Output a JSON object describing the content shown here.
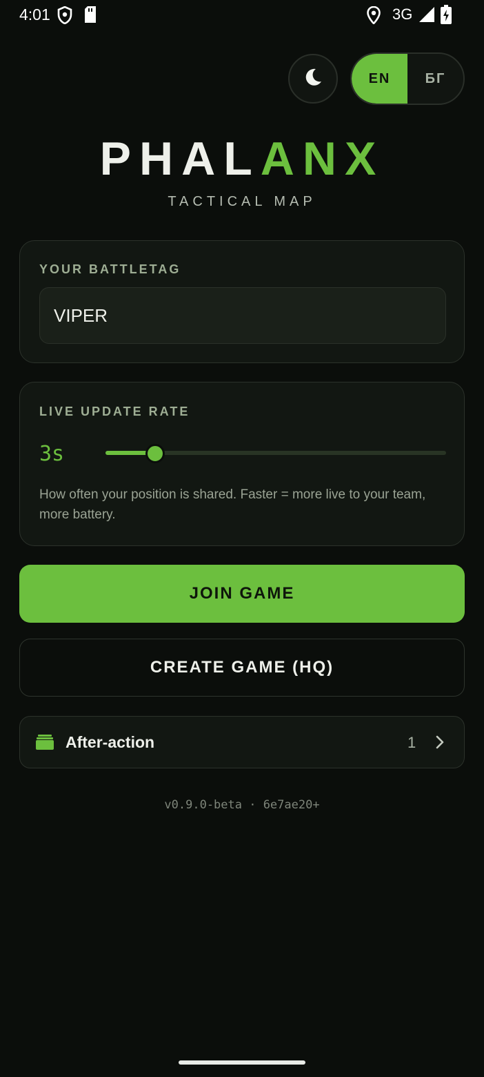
{
  "status_bar": {
    "time": "4:01",
    "network": "3G",
    "icons": [
      "shield-icon",
      "sd-card-icon",
      "location-icon",
      "signal-icon",
      "battery-charging-icon"
    ]
  },
  "header": {
    "theme_icon": "moon-icon",
    "languages": [
      {
        "label": "EN",
        "active": true
      },
      {
        "label": "БГ",
        "active": false
      }
    ]
  },
  "logo": {
    "part_white": "PHAL",
    "part_green": "ANX",
    "subtitle": "TACTICAL MAP"
  },
  "battletag": {
    "label": "YOUR BATTLETAG",
    "value": "VIPER"
  },
  "update_rate": {
    "label": "LIVE UPDATE RATE",
    "value": "3s",
    "slider_fraction": 0.145,
    "help": "How often your position is shared. Faster = more live to your team, more battery."
  },
  "actions": {
    "join": "JOIN GAME",
    "create": "CREATE GAME (HQ)"
  },
  "after_action": {
    "label": "After-action",
    "count": "1",
    "icon": "archive-icon"
  },
  "version": "v0.9.0-beta · 6e7ae20+",
  "colors": {
    "accent": "#6cbf3e",
    "background": "#0b0e0b",
    "card": "#121712"
  }
}
